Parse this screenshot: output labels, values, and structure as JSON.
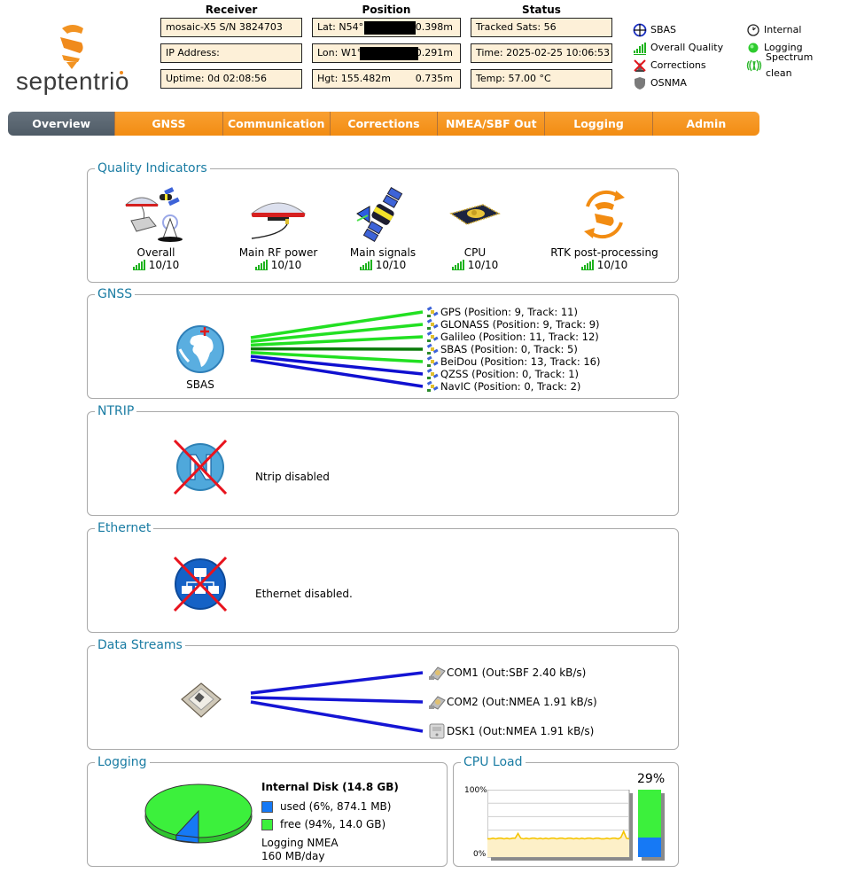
{
  "brand": {
    "name": "septentrio",
    "accent": "#f28c12"
  },
  "header": {
    "receiver": {
      "title": "Receiver",
      "model": "mosaic-X5 S/N 3824703",
      "ip": "IP Address:",
      "uptime": "Uptime: 0d 02:08:56"
    },
    "position": {
      "title": "Position",
      "lat_label": "Lat:  N54°",
      "lat_acc": "0.398m",
      "lon_label": "Lon: W1°",
      "lon_acc": "0.291m",
      "hgt_label": "Hgt: 155.482m",
      "hgt_acc": "0.735m"
    },
    "status": {
      "title": "Status",
      "tracked": "Tracked Sats: 56",
      "time": "Time: 2025-02-25 10:06:53",
      "temp": "Temp: 57.00 °C"
    },
    "legend": [
      {
        "icon": "sbas-crosshair-icon",
        "label": "SBAS"
      },
      {
        "icon": "signal-bars-icon",
        "label": "Overall Quality"
      },
      {
        "icon": "corrections-disabled-icon",
        "label": "Corrections"
      },
      {
        "icon": "shield-icon",
        "label": "OSNMA"
      },
      {
        "icon": "clock-icon",
        "label": "Internal"
      },
      {
        "icon": "green-led-icon",
        "label": "Logging"
      },
      {
        "icon": "spectrum-icon",
        "label": "Spectrum clean"
      }
    ]
  },
  "nav": {
    "tabs": [
      "Overview",
      "GNSS",
      "Communication",
      "Corrections",
      "NMEA/SBF Out",
      "Logging",
      "Admin"
    ],
    "active": "Overview"
  },
  "quality": {
    "title": "Quality Indicators",
    "items": [
      {
        "name": "Overall",
        "value": "10/10"
      },
      {
        "name": "Main RF power",
        "value": "10/10"
      },
      {
        "name": "Main signals",
        "value": "10/10"
      },
      {
        "name": "CPU",
        "value": "10/10"
      },
      {
        "name": "RTK post-processing",
        "value": "10/10"
      }
    ]
  },
  "gnss": {
    "title": "GNSS",
    "source_label": "SBAS",
    "constellations": [
      {
        "label": "GPS (Position: 9, Track: 11)",
        "color": "#22e022"
      },
      {
        "label": "GLONASS (Position: 9, Track: 9)",
        "color": "#22e022"
      },
      {
        "label": "Galileo (Position: 11, Track: 12)",
        "color": "#22e022"
      },
      {
        "label": "SBAS (Position: 0, Track: 5)",
        "color": "#0a7a0a"
      },
      {
        "label": "BeiDou (Position: 13, Track: 16)",
        "color": "#22e022"
      },
      {
        "label": "QZSS (Position: 0, Track: 1)",
        "color": "#1010d0"
      },
      {
        "label": "NavIC (Position: 0, Track: 2)",
        "color": "#1010d0"
      }
    ]
  },
  "ntrip": {
    "title": "NTRIP",
    "status": "Ntrip disabled"
  },
  "ethernet": {
    "title": "Ethernet",
    "status": "Ethernet disabled."
  },
  "streams": {
    "title": "Data Streams",
    "items": [
      {
        "icon": "serial-port-icon",
        "label": "COM1 (Out:SBF 2.40 kB/s)"
      },
      {
        "icon": "serial-port-icon",
        "label": "COM2 (Out:NMEA 1.91 kB/s)"
      },
      {
        "icon": "disk-icon",
        "label": "DSK1 (Out:NMEA 1.91 kB/s)"
      }
    ]
  },
  "logging": {
    "title": "Logging",
    "disk_title": "Internal Disk (14.8 GB)",
    "used_label": "used (6%, 874.1 MB)",
    "free_label": "free (94%, 14.0 GB)",
    "used_fraction": 0.06,
    "used_color": "#1679f5",
    "free_color": "#3cf03c",
    "mode": "Logging NMEA",
    "rate": "160 MB/day"
  },
  "cpu": {
    "title": "CPU Load",
    "current": "29%",
    "current_value": 29,
    "y_max_label": "100%",
    "y_min_label": "0%",
    "history": [
      27,
      27,
      28,
      27,
      28,
      28,
      27,
      28,
      27,
      28,
      28,
      35,
      28,
      27,
      28,
      27,
      28,
      28,
      27,
      28,
      27,
      28,
      27,
      28,
      28,
      27,
      28,
      28,
      27,
      28,
      28,
      27,
      28,
      27,
      28,
      27,
      28,
      28,
      27,
      28,
      28,
      27,
      27,
      28,
      27,
      28,
      28,
      27,
      29,
      38,
      28,
      27
    ]
  }
}
